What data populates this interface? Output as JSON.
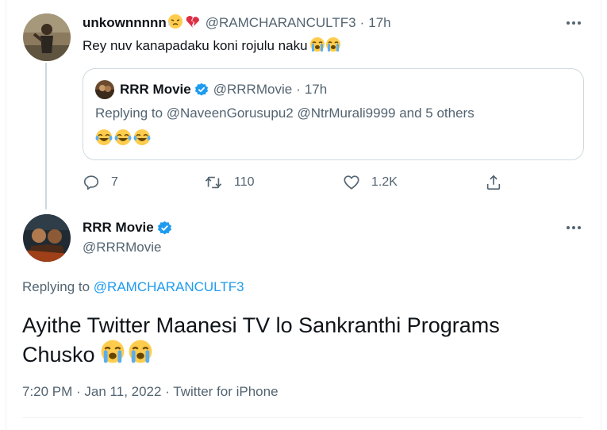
{
  "reply_tweet": {
    "display_name": "unkownnnnn",
    "handle": "@RAMCHARANCULTF3",
    "time": "17h",
    "text": "Rey nuv kanapadaku koni rojulu naku",
    "emojis_after_name": [
      "face-with-steam-emoji",
      "broken-heart-emoji"
    ],
    "emojis_after_text": [
      "loudly-crying-face-emoji",
      "loudly-crying-face-emoji"
    ],
    "quoted": {
      "display_name": "RRR Movie",
      "handle": "@RRRMovie",
      "time": "17h",
      "verified": true,
      "text": "Replying to @NaveenGorusupu2 @NtrMurali9999 and 5 others",
      "emojis": [
        "face-with-tears-of-joy-emoji",
        "face-with-tears-of-joy-emoji",
        "face-with-tears-of-joy-emoji"
      ]
    },
    "actions": {
      "replies": "7",
      "retweets": "110",
      "likes": "1.2K"
    }
  },
  "main_tweet": {
    "display_name": "RRR Movie",
    "handle": "@RRRMovie",
    "verified": true,
    "replying_prefix": "Replying to",
    "replying_to": "@RAMCHARANCULTF3",
    "text_line1": "Ayithe Twitter Maanesi TV lo Sankranthi Programs",
    "text_line2": "Chusko",
    "emojis": [
      "loudly-crying-face-emoji",
      "loudly-crying-face-emoji"
    ],
    "timestamp": "7:20 PM · Jan 11, 2022 · Twitter for iPhone"
  },
  "colors": {
    "text": "#0f1419",
    "secondary": "#536471",
    "link": "#1d9bf0",
    "border": "#cfd9de",
    "emoji_yellow": "#ffcc4d",
    "emoji_tear": "#5dadec",
    "heart_red": "#dd2e44"
  }
}
